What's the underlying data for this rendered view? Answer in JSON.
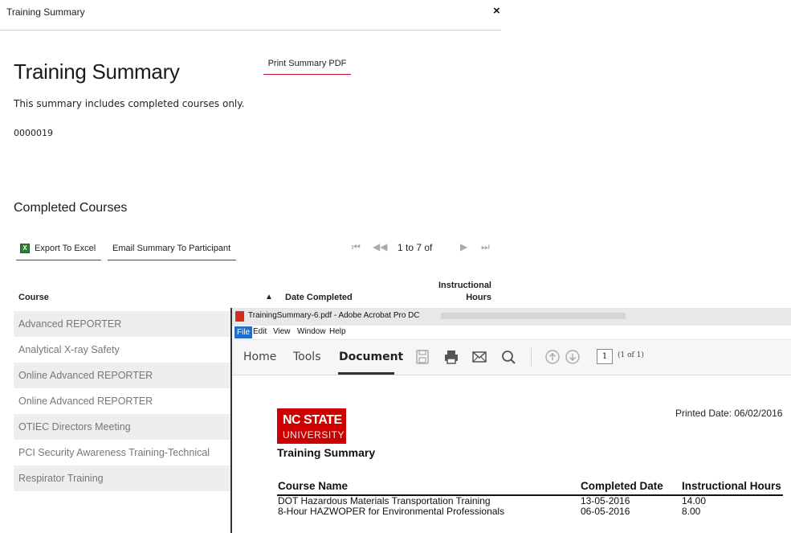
{
  "modal": {
    "header_title": "Training Summary",
    "close_glyph": "×",
    "title": "Training Summary",
    "print_button": "Print Summary PDF",
    "note": "This summary includes completed courses only.",
    "id_code": "0000019"
  },
  "completed": {
    "section_title": "Completed Courses",
    "export_button": "Export To Excel",
    "email_button": "Email Summary To Participant",
    "pager": {
      "first": "⏮",
      "prev": "◀◀",
      "range": "1 to 7 of",
      "next": "▶",
      "last": "⏭"
    },
    "columns": {
      "course": "Course",
      "sort_arrow": "▲",
      "date": "Date Completed",
      "hours": "Instructional Hours"
    },
    "courses": [
      "Advanced REPORTER",
      "Analytical X-ray Safety",
      "Online Advanced REPORTER",
      "Online Advanced REPORTER",
      "OTIEC Directors Meeting",
      "PCI Security Awareness Training-Technical",
      "Respirator Training"
    ]
  },
  "acrobat": {
    "window_title": "TrainingSummary-6.pdf - Adobe Acrobat Pro DC",
    "menu": [
      "File",
      "Edit",
      "View",
      "Window",
      "Help"
    ],
    "tabs": [
      "Home",
      "Tools",
      "Document"
    ],
    "toolbar_icons": [
      "save-icon",
      "print-icon",
      "email-icon",
      "search-icon",
      "page-up-icon",
      "page-down-icon"
    ],
    "page_number": "1",
    "page_of": "(1 of 1)",
    "document": {
      "logo_line1": "NC STATE",
      "logo_line2": "UNIVERSITY",
      "logo_color": "#cc0000",
      "printed_date": "Printed Date: 06/02/2016",
      "title": "Training Summary",
      "headers": {
        "course": "Course Name",
        "completed": "Completed Date",
        "hours": "Instructional Hours"
      },
      "rows": [
        {
          "course": "DOT Hazardous Materials Transportation Training",
          "date": "13-05-2016",
          "hours": "14.00"
        },
        {
          "course": "8-Hour HAZWOPER for Environmental Professionals",
          "date": "06-05-2016",
          "hours": "8.00"
        }
      ]
    }
  },
  "colors": {
    "accent_underline": "#c8102e",
    "row_shade": "#eeeeee",
    "acrobat_menu_active": "#1f6fd0"
  }
}
